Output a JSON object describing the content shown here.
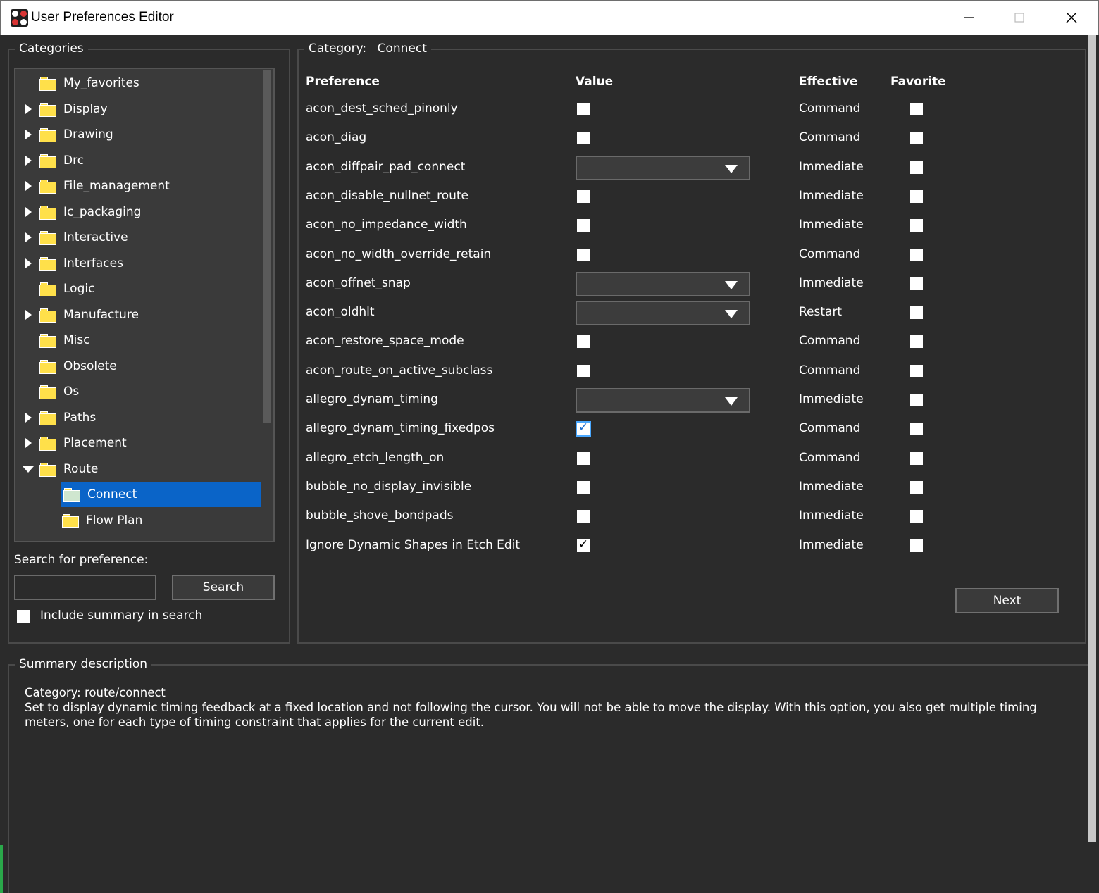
{
  "window": {
    "title": "User Preferences Editor"
  },
  "categories": {
    "legend": "Categories",
    "items": [
      {
        "label": "My_favorites",
        "expander": "none",
        "depth": 0
      },
      {
        "label": "Display",
        "expander": "right",
        "depth": 0
      },
      {
        "label": "Drawing",
        "expander": "right",
        "depth": 0
      },
      {
        "label": "Drc",
        "expander": "right",
        "depth": 0
      },
      {
        "label": "File_management",
        "expander": "right",
        "depth": 0
      },
      {
        "label": "Ic_packaging",
        "expander": "right",
        "depth": 0
      },
      {
        "label": "Interactive",
        "expander": "right",
        "depth": 0
      },
      {
        "label": "Interfaces",
        "expander": "right",
        "depth": 0
      },
      {
        "label": "Logic",
        "expander": "none",
        "depth": 0
      },
      {
        "label": "Manufacture",
        "expander": "right",
        "depth": 0
      },
      {
        "label": "Misc",
        "expander": "none",
        "depth": 0
      },
      {
        "label": "Obsolete",
        "expander": "none",
        "depth": 0
      },
      {
        "label": "Os",
        "expander": "none",
        "depth": 0
      },
      {
        "label": "Paths",
        "expander": "right",
        "depth": 0
      },
      {
        "label": "Placement",
        "expander": "right",
        "depth": 0
      },
      {
        "label": "Route",
        "expander": "down",
        "depth": 0
      },
      {
        "label": "Connect",
        "expander": "none",
        "depth": 1,
        "selected": true
      },
      {
        "label": "Flow Plan",
        "expander": "none",
        "depth": 1
      }
    ]
  },
  "search": {
    "label": "Search for preference:",
    "value": "",
    "button": "Search",
    "include_summary_label": "Include summary in search",
    "include_summary_checked": false
  },
  "category_panel": {
    "legend_prefix": "Category:",
    "legend_value": "Connect",
    "headers": {
      "preference": "Preference",
      "value": "Value",
      "effective": "Effective",
      "favorite": "Favorite"
    },
    "rows": [
      {
        "name": "acon_dest_sched_pinonly",
        "type": "checkbox",
        "checked": false,
        "effective": "Command"
      },
      {
        "name": "acon_diag",
        "type": "checkbox",
        "checked": false,
        "effective": "Command"
      },
      {
        "name": "acon_diffpair_pad_connect",
        "type": "dropdown",
        "value": "",
        "effective": "Immediate"
      },
      {
        "name": "acon_disable_nullnet_route",
        "type": "checkbox",
        "checked": false,
        "effective": "Immediate"
      },
      {
        "name": "acon_no_impedance_width",
        "type": "checkbox",
        "checked": false,
        "effective": "Immediate"
      },
      {
        "name": "acon_no_width_override_retain",
        "type": "checkbox",
        "checked": false,
        "effective": "Command"
      },
      {
        "name": "acon_offnet_snap",
        "type": "dropdown",
        "value": "",
        "effective": "Immediate"
      },
      {
        "name": "acon_oldhlt",
        "type": "dropdown",
        "value": "",
        "effective": "Restart"
      },
      {
        "name": "acon_restore_space_mode",
        "type": "checkbox",
        "checked": false,
        "effective": "Command"
      },
      {
        "name": "acon_route_on_active_subclass",
        "type": "checkbox",
        "checked": false,
        "effective": "Command"
      },
      {
        "name": "allegro_dynam_timing",
        "type": "dropdown",
        "value": "",
        "effective": "Immediate"
      },
      {
        "name": "allegro_dynam_timing_fixedpos",
        "type": "checkbox",
        "checked": true,
        "focused": true,
        "effective": "Command"
      },
      {
        "name": "allegro_etch_length_on",
        "type": "checkbox",
        "checked": false,
        "effective": "Command"
      },
      {
        "name": "bubble_no_display_invisible",
        "type": "checkbox",
        "checked": false,
        "effective": "Immediate"
      },
      {
        "name": "bubble_shove_bondpads",
        "type": "checkbox",
        "checked": false,
        "effective": "Immediate"
      },
      {
        "name": "Ignore Dynamic Shapes in Etch Edit",
        "type": "checkbox",
        "checked": true,
        "effective": "Immediate"
      }
    ],
    "next_button": "Next"
  },
  "summary": {
    "legend": "Summary description",
    "category_line": "Category: route/connect",
    "text": "Set to display dynamic timing feedback at a fixed location and not following the cursor. You will not be able to move the display. With this option, you also get multiple timing meters, one for each type of timing constraint that applies for the current edit."
  }
}
